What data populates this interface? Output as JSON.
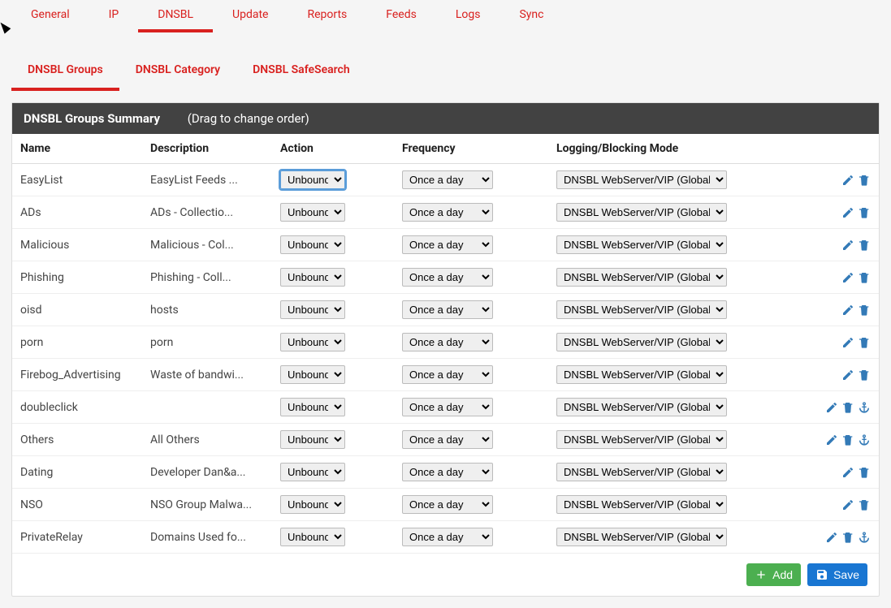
{
  "tabs_primary": [
    "General",
    "IP",
    "DNSBL",
    "Update",
    "Reports",
    "Feeds",
    "Logs",
    "Sync"
  ],
  "tabs_primary_active": "DNSBL",
  "tabs_secondary": [
    "DNSBL Groups",
    "DNSBL Category",
    "DNSBL SafeSearch"
  ],
  "tabs_secondary_active": "DNSBL Groups",
  "panel": {
    "title": "DNSBL Groups Summary",
    "subtitle": "(Drag to change order)"
  },
  "columns": {
    "name": "Name",
    "description": "Description",
    "action": "Action",
    "frequency": "Frequency",
    "mode": "Logging/Blocking Mode"
  },
  "select_values": {
    "action": "Unbound",
    "frequency": "Once a day",
    "mode": "DNSBL WebServer/VIP (Global)"
  },
  "rows": [
    {
      "name": "EasyList",
      "description": "EasyList Feeds ...",
      "focused": true,
      "anchor": false
    },
    {
      "name": "ADs",
      "description": "ADs - Collectio...",
      "focused": false,
      "anchor": false
    },
    {
      "name": "Malicious",
      "description": "Malicious - Col...",
      "focused": false,
      "anchor": false
    },
    {
      "name": "Phishing",
      "description": "Phishing - Coll...",
      "focused": false,
      "anchor": false
    },
    {
      "name": "oisd",
      "description": "hosts",
      "focused": false,
      "anchor": false
    },
    {
      "name": "porn",
      "description": "porn",
      "focused": false,
      "anchor": false
    },
    {
      "name": "Firebog_Advertising",
      "description": "Waste of bandwi...",
      "focused": false,
      "anchor": false
    },
    {
      "name": "doubleclick",
      "description": "",
      "focused": false,
      "anchor": true
    },
    {
      "name": "Others",
      "description": "All Others",
      "focused": false,
      "anchor": true
    },
    {
      "name": "Dating",
      "description": "Developer Dan&a...",
      "focused": false,
      "anchor": false
    },
    {
      "name": "NSO",
      "description": "NSO Group Malwa...",
      "focused": false,
      "anchor": false
    },
    {
      "name": "PrivateRelay",
      "description": "Domains Used fo...",
      "focused": false,
      "anchor": true
    }
  ],
  "buttons": {
    "add": "Add",
    "save": "Save"
  }
}
